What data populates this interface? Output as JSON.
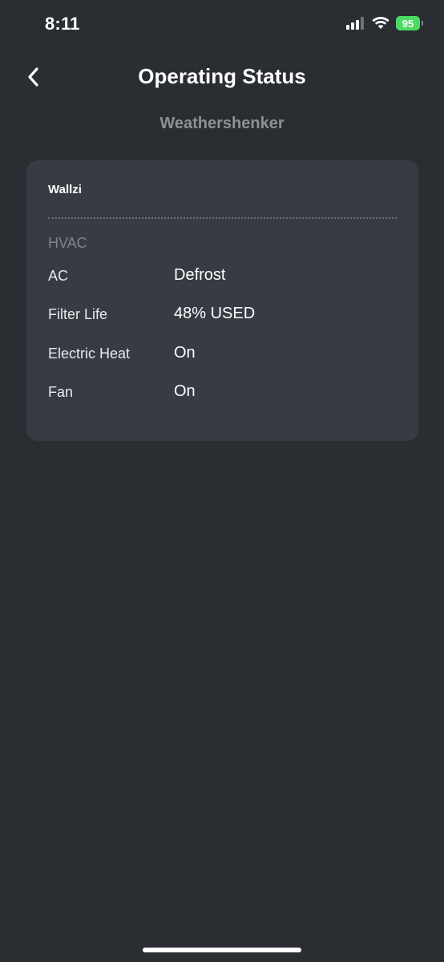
{
  "status_bar": {
    "time": "8:11",
    "battery_level": "95",
    "icons": [
      "signal-icon",
      "wifi-icon",
      "battery-icon"
    ],
    "battery_color": "#4cd964"
  },
  "header": {
    "back_icon": "chevron-left-icon",
    "title": "Operating Status",
    "subtitle": "Weathershenker"
  },
  "card": {
    "device_name": "Wallzi",
    "section_label": "HVAC",
    "rows": [
      {
        "label": "AC",
        "value": "Defrost"
      },
      {
        "label": "Filter Life",
        "value": "48% USED"
      },
      {
        "label": "Electric Heat",
        "value": "On"
      },
      {
        "label": "Fan",
        "value": "On"
      }
    ]
  },
  "colors": {
    "background": "#2a2e32",
    "card": "#373b43",
    "subtitle": "#8d9196"
  }
}
